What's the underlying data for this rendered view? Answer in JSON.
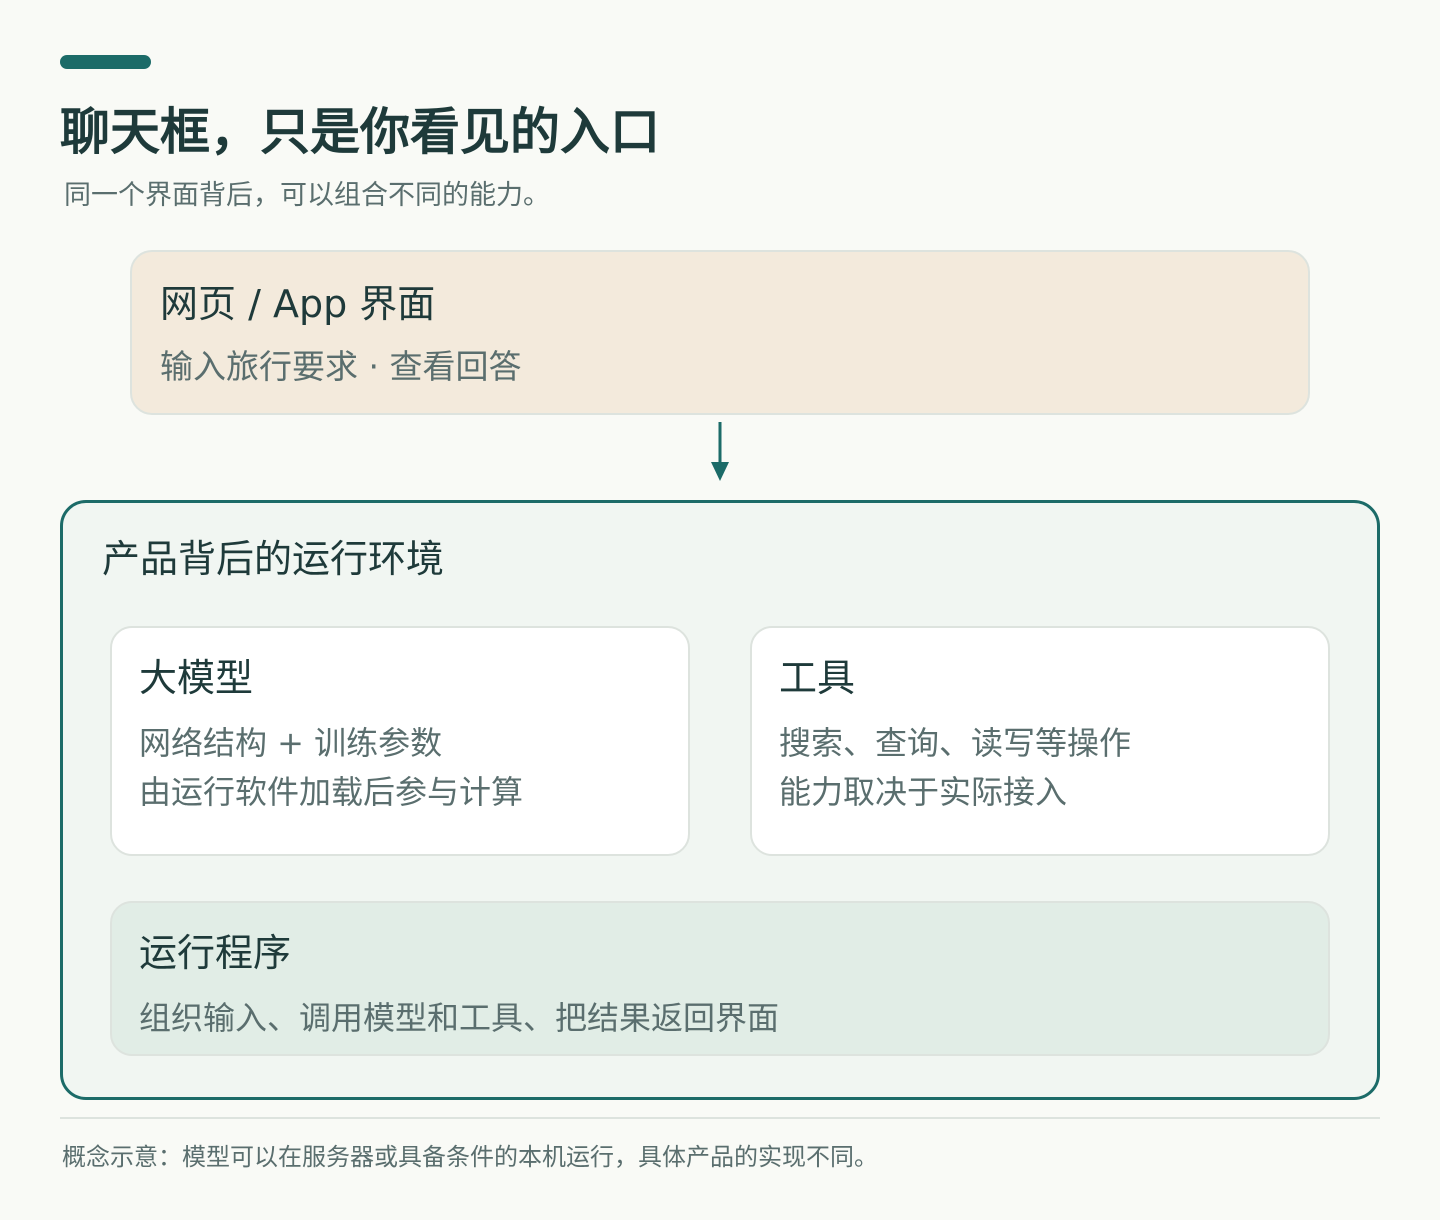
{
  "header": {
    "title": "聊天框，只是你看见的入口",
    "subtitle": "同一个界面背后，可以组合不同的能力。"
  },
  "ui_box": {
    "title": "网页 / App 界面",
    "desc": "输入旅行要求 · 查看回答"
  },
  "runtime": {
    "title": "产品背后的运行环境",
    "model": {
      "title": "大模型",
      "lines": [
        "网络结构 + 训练参数",
        "由运行软件加载后参与计算"
      ]
    },
    "tools": {
      "title": "工具",
      "lines": [
        "搜索、查询、读写等操作",
        "能力取决于实际接入"
      ]
    },
    "program": {
      "title": "运行程序",
      "desc": "组织输入、调用模型和工具、把结果返回界面"
    }
  },
  "footnote": "概念示意：模型可以在服务器或具备条件的本机运行，具体产品的实现不同。",
  "colors": {
    "accent": "#1c6b68",
    "ui_box_bg": "#f3eadc",
    "runtime_bg": "#f1f6f2",
    "program_bg": "#e1ede6",
    "text_primary": "#1e3a3a",
    "text_secondary": "#5a6e6e"
  }
}
